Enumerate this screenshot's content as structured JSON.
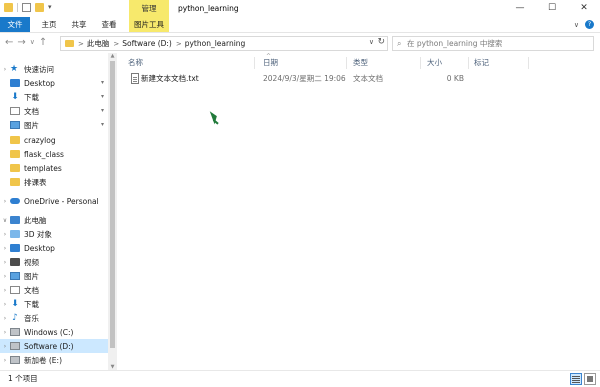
{
  "titlebar": {
    "manage_tab": "管理",
    "title": "python_learning",
    "minimize": "—",
    "maximize": "☐",
    "close": "✕"
  },
  "ribbon": {
    "tabs": [
      {
        "label": "文件"
      },
      {
        "label": "主页"
      },
      {
        "label": "共享"
      },
      {
        "label": "查看"
      },
      {
        "label": "图片工具"
      }
    ],
    "expand_icon": "chevron-down-icon",
    "help_icon": "help-icon",
    "expand": "∨",
    "help": "?"
  },
  "address": {
    "back": "←",
    "forward": "→",
    "recent": "∨",
    "up": "↑",
    "breadcrumb": [
      "此电脑",
      "Software (D:)",
      "python_learning"
    ],
    "sep": ">",
    "dropdown": "∨",
    "refresh": "↻",
    "search_placeholder": "在 python_learning 中搜索",
    "search_icon": "⌕"
  },
  "nav_pane": {
    "items": [
      {
        "label": "快速访问",
        "icon": "star-icon",
        "expand": "›"
      },
      {
        "label": "Desktop",
        "icon": "desktop-icon",
        "pinned": true
      },
      {
        "label": "下载",
        "icon": "download-icon",
        "pinned": true
      },
      {
        "label": "文档",
        "icon": "document-icon",
        "pinned": true
      },
      {
        "label": "图片",
        "icon": "picture-icon",
        "pinned": true
      },
      {
        "label": "crazylog",
        "icon": "folder-icon"
      },
      {
        "label": "flask_class",
        "icon": "folder-icon"
      },
      {
        "label": "templates",
        "icon": "folder-icon"
      },
      {
        "label": "排课表",
        "icon": "folder-icon"
      },
      {
        "label": "OneDrive - Personal",
        "icon": "onedrive-icon",
        "expand": "›"
      },
      {
        "label": "此电脑",
        "icon": "computer-icon",
        "expand": "∨"
      },
      {
        "label": "3D 对象",
        "icon": "3d-objects-icon",
        "expand": "›"
      },
      {
        "label": "Desktop",
        "icon": "desktop-icon",
        "expand": "›"
      },
      {
        "label": "视频",
        "icon": "video-icon",
        "expand": "›"
      },
      {
        "label": "图片",
        "icon": "picture-icon",
        "expand": "›"
      },
      {
        "label": "文档",
        "icon": "document-icon",
        "expand": "›"
      },
      {
        "label": "下载",
        "icon": "download-icon",
        "expand": "›"
      },
      {
        "label": "音乐",
        "icon": "music-icon",
        "expand": "›"
      },
      {
        "label": "Windows (C:)",
        "icon": "drive-icon",
        "expand": "›"
      },
      {
        "label": "Software (D:)",
        "icon": "drive-icon",
        "expand": "›",
        "selected": true
      },
      {
        "label": "新加卷 (E:)",
        "icon": "drive-icon",
        "expand": "›"
      }
    ],
    "pin_glyph": "📌"
  },
  "file_list": {
    "columns": [
      "名称",
      "日期",
      "类型",
      "大小",
      "标记"
    ],
    "collapse": "^",
    "files": [
      {
        "name": "新建文本文档.txt",
        "date": "2024/9/3/星期二 19:06",
        "type": "文本文档",
        "size": "0 KB",
        "tags": ""
      }
    ]
  },
  "status": {
    "item_count": "1 个项目"
  },
  "colors": {
    "accent": "#1979ca",
    "manage_tab": "#f7e96c",
    "selection": "#cce8ff",
    "folder": "#f0c54a"
  }
}
